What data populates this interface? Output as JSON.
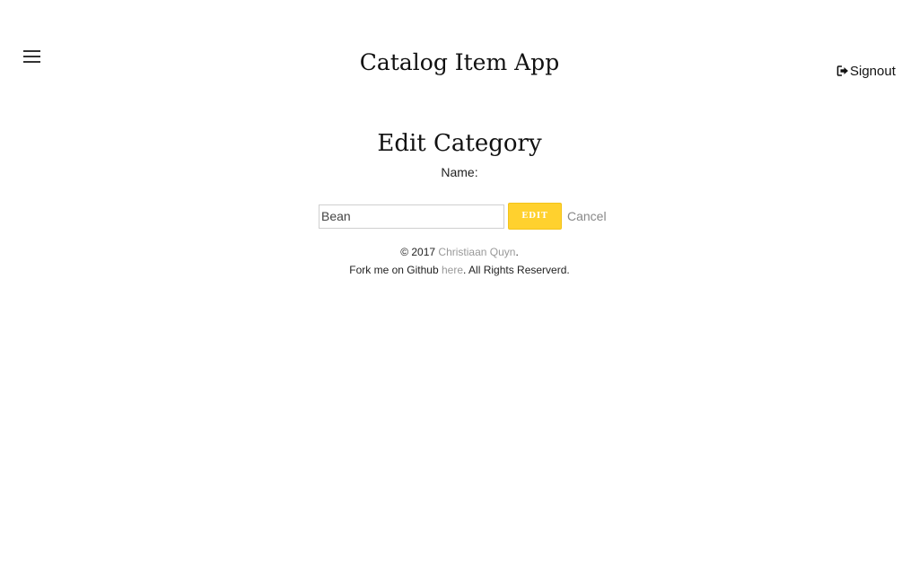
{
  "header": {
    "title": "Catalog Item App",
    "signout_label": "Signout"
  },
  "main": {
    "page_title": "Edit Category",
    "name_label": "Name:",
    "name_value": "Bean",
    "edit_label": "EDIT",
    "cancel_label": "Cancel"
  },
  "footer": {
    "copyright_prefix": "© 2017 ",
    "author_link": "Christiaan Quyn",
    "copyright_suffix": ".",
    "fork_prefix": "Fork me on Github ",
    "fork_link": "here",
    "fork_suffix": ". All Rights Reserverd."
  },
  "icons": {
    "menu": "hamburger-menu-icon",
    "signout": "sign-out-icon"
  },
  "colors": {
    "edit_button": "#ffd12e",
    "link": "#999999",
    "cancel": "#888888"
  }
}
